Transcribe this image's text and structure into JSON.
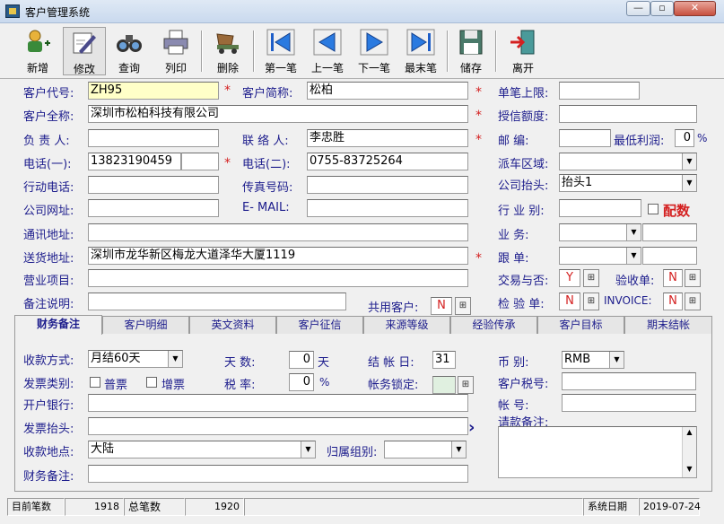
{
  "window": {
    "title": "客户管理系统"
  },
  "toolbar": [
    "新增",
    "修改",
    "查询",
    "列印",
    "删除",
    "第一笔",
    "上一笔",
    "下一笔",
    "最末笔",
    "储存",
    "离开"
  ],
  "labels": {
    "customer_code": "客户代号:",
    "customer_short": "客户简称:",
    "single_limit": "单笔上限:",
    "customer_full": "客户全称:",
    "credit_limit": "授信额度:",
    "responsible": "负 责 人:",
    "contact": "联 络 人:",
    "postal": "邮    编:",
    "min_profit": "最低利润:",
    "pct": "%",
    "phone1": "电话(一):",
    "phone2": "电话(二):",
    "dispatch_area": "派车区域:",
    "mobile": "行动电话:",
    "fax": "传真号码:",
    "company_header": "公司抬头:",
    "website": "公司网址:",
    "email": "E- MAIL:",
    "industry": "行 业 别:",
    "match": "配数",
    "mail_addr": "通讯地址:",
    "business": "业    务:",
    "delivery_addr": "送货地址:",
    "follow": "跟    单:",
    "business_items": "营业项目:",
    "trade": "交易与否:",
    "accept_order": "验收单:",
    "remarks": "备注说明:",
    "shared": "共用客户:",
    "inspection": "检 验 单:",
    "invoice": "INVOICE:"
  },
  "values": {
    "customer_code": "ZH95",
    "customer_short": "松柏",
    "customer_full": "深圳市松柏科技有限公司",
    "contact": "李忠胜",
    "phone1": "13823190459",
    "phone2": "0755-83725264",
    "min_profit": "0",
    "company_header": "抬头1",
    "delivery_addr": "深圳市龙华新区梅龙大道泽华大厦1119",
    "shared": "N",
    "trade": "Y",
    "accept_order": "N",
    "inspection": "N",
    "invoice": "N"
  },
  "tabs": [
    "财务备注",
    "客户明细",
    "英文资料",
    "客户征信",
    "来源等级",
    "经验传承",
    "客户目标",
    "期末结帐"
  ],
  "finance": {
    "pay_method_label": "收款方式:",
    "pay_method": "月结60天",
    "days_label": "天      数:",
    "days": "0",
    "day_unit": "天",
    "settle_label": "结 帐 日:",
    "settle": "31",
    "currency_label": "币      别:",
    "currency": "RMB",
    "invoice_type_label": "发票类别:",
    "opt1": "普票",
    "opt2": "增票",
    "tax_label": "税      率:",
    "tax": "0",
    "tax_unit": "%",
    "lock_label": "帐务锁定:",
    "tax_no_label": "客户税号:",
    "bank_label": "开户银行:",
    "account_label": "帐      号:",
    "invoice_header_label": "发票抬头:",
    "pay_note_label": "请款备注:",
    "pay_place_label": "收款地点:",
    "pay_place": "大陆",
    "group_label": "归属组别:",
    "finance_note_label": "财务备注:",
    "arrow": "›"
  },
  "status": {
    "current_label": "目前笔数",
    "current": "1918",
    "total_label": "总笔数",
    "total": "1920",
    "date_label": "系统日期",
    "date": "2019-07-24"
  }
}
